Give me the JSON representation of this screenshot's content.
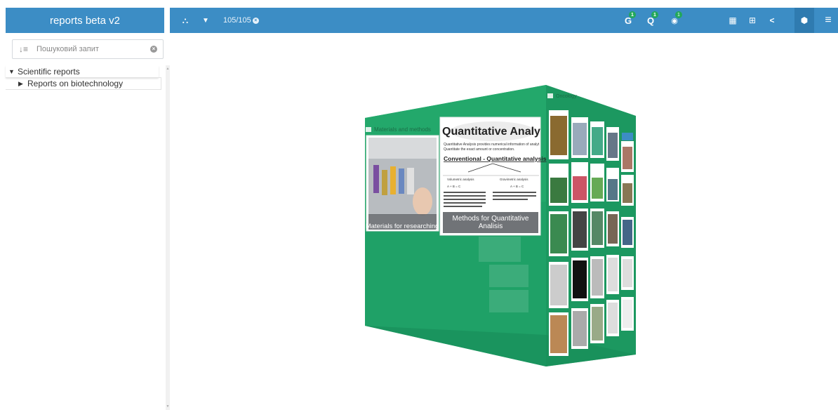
{
  "app": {
    "title": "reports beta v2"
  },
  "toolbar": {
    "counter": "105/105",
    "counter_clear": "×",
    "items": [
      {
        "name": "hierarchy-icon",
        "glyph": "⛬"
      },
      {
        "name": "filter-icon",
        "glyph": "▼"
      }
    ],
    "badged": [
      {
        "name": "google-search-button",
        "glyph": "G",
        "badge": "1"
      },
      {
        "name": "search-button",
        "glyph": "Q",
        "badge": "1"
      },
      {
        "name": "view-button",
        "glyph": "◉",
        "badge": "1"
      }
    ],
    "right": [
      {
        "name": "grid-view-icon",
        "glyph": "▦"
      },
      {
        "name": "table-view-icon",
        "glyph": "⊞"
      },
      {
        "name": "share-icon",
        "glyph": "<"
      },
      {
        "name": "cube-view-icon",
        "glyph": "⬢",
        "active": true
      },
      {
        "name": "menu-icon",
        "glyph": "≡"
      }
    ]
  },
  "search": {
    "placeholder": "Пошуковий запит",
    "sort_icon": "↓≡",
    "clear": "×"
  },
  "tree": {
    "root": {
      "label": "Scientific reports",
      "expanded": true
    },
    "children": [
      {
        "label": "Reports on biotechnology",
        "expanded": false
      }
    ]
  },
  "cube": {
    "front_header": "Materials and methods",
    "right_header": "Oncology",
    "cards": [
      {
        "caption": "Materials for researching"
      },
      {
        "caption": "Methods for Quantitative Analisis"
      }
    ],
    "slide": {
      "title": "Quantitative Analy",
      "line1": "Quantitative Analysis provides numerical information of analyt",
      "line2": "Quantitate the exact amount or concentration.",
      "heading": "Conventional - Quantitative analysis",
      "left_label": "Volumetric analysis",
      "right_label": "Gravimetric analysis",
      "formula": "A + B = C"
    },
    "colors": {
      "face": "#1fa067",
      "front": "#23a86b",
      "right": "#1c9860",
      "top": "#2cb677"
    }
  }
}
